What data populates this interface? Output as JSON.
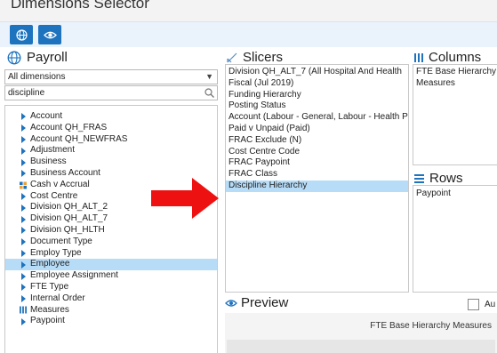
{
  "window": {
    "title": "Dimensions Selector"
  },
  "toolbar": {
    "buttons": [
      {
        "icon": "globe-icon"
      },
      {
        "icon": "eye-icon"
      }
    ]
  },
  "left": {
    "header": "Payroll",
    "dimension_filter": "All dimensions",
    "search_value": "discipline",
    "tree": [
      {
        "label": "Account",
        "icon": "triangle"
      },
      {
        "label": "Account QH_FRAS",
        "icon": "triangle"
      },
      {
        "label": "Account QH_NEWFRAS",
        "icon": "triangle"
      },
      {
        "label": "Adjustment",
        "icon": "triangle"
      },
      {
        "label": "Business",
        "icon": "triangle"
      },
      {
        "label": "Business Account",
        "icon": "triangle"
      },
      {
        "label": "Cash v Accrual",
        "icon": "grid"
      },
      {
        "label": "Cost Centre",
        "icon": "triangle"
      },
      {
        "label": "Division QH_ALT_2",
        "icon": "triangle"
      },
      {
        "label": "Division QH_ALT_7",
        "icon": "triangle"
      },
      {
        "label": "Division QH_HLTH",
        "icon": "triangle"
      },
      {
        "label": "Document Type",
        "icon": "triangle"
      },
      {
        "label": "Employ Type",
        "icon": "triangle"
      },
      {
        "label": "Employee",
        "icon": "triangle",
        "selected": true
      },
      {
        "label": "Employee Assignment",
        "icon": "triangle"
      },
      {
        "label": "FTE Type",
        "icon": "triangle"
      },
      {
        "label": "Internal Order",
        "icon": "triangle"
      },
      {
        "label": "Measures",
        "icon": "bars"
      },
      {
        "label": "Paypoint",
        "icon": "triangle"
      }
    ]
  },
  "slicers": {
    "header": "Slicers",
    "items": [
      {
        "label": "Division QH_ALT_7 (All Hospital And Health"
      },
      {
        "label": "Fiscal (Jul 2019)"
      },
      {
        "label": "Funding Hierarchy"
      },
      {
        "label": "Posting Status"
      },
      {
        "label": "Account (Labour - General, Labour - Health P"
      },
      {
        "label": "Paid v Unpaid (Paid)"
      },
      {
        "label": "FRAC Exclude (N)"
      },
      {
        "label": "Cost Centre Code"
      },
      {
        "label": "FRAC Paypoint"
      },
      {
        "label": "FRAC Class"
      },
      {
        "label": "Discipline Hierarchy",
        "selected": true
      }
    ]
  },
  "columns": {
    "header": "Columns",
    "items": [
      "FTE Base Hierarchy",
      "Measures"
    ]
  },
  "rows": {
    "header": "Rows",
    "items": [
      "Paypoint"
    ]
  },
  "preview": {
    "header": "Preview",
    "auto_label": "Au",
    "column_fields": "FTE Base Hierarchy  Measures"
  }
}
